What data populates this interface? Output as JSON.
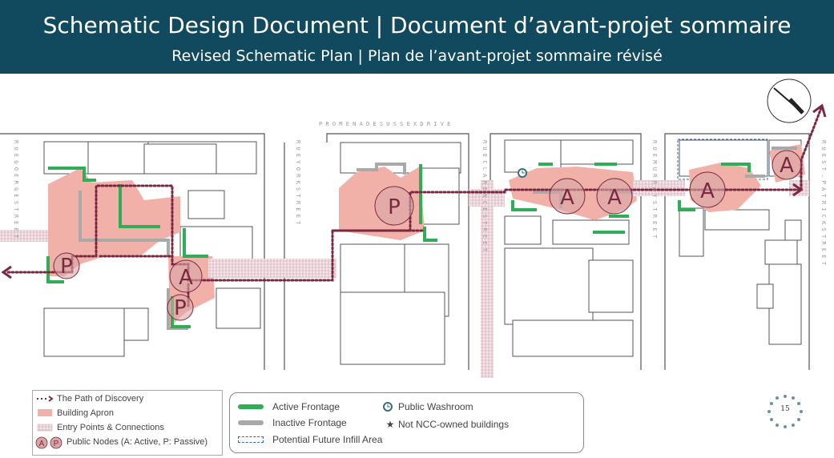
{
  "header": {
    "title": "Schematic Design Document | Document d’avant-projet sommaire",
    "subtitle": "Revised Schematic Plan | Plan de l’avant-projet sommaire révisé"
  },
  "streets": {
    "promenade": "P R O M E N A D E   S U S S E X   D R I V E",
    "george": "R U E   G O E R G E   S T R E E T",
    "york": "R U E   Y O R K   S T R E E T",
    "clarence": "R U E   C L A R E N C E   S T R E E T",
    "murray": "R U E   M U R R A Y   S T R E E T",
    "st_patrick": "R U E   S T .   P A T R I C K   S T R E E T"
  },
  "nodes": {
    "active": "A",
    "passive": "P"
  },
  "legend_left": {
    "path": "The Path of Discovery",
    "apron": "Building Apron",
    "entry": "Entry Points & Connections",
    "nodes": "Public Nodes (A: Active, P: Passive)",
    "node_a": "A",
    "node_p": "P"
  },
  "legend_mid": {
    "active": "Active Frontage",
    "inactive": "Inactive Frontage",
    "infill": "Potential Future Infill Area",
    "washroom": "Public Washroom",
    "ncc": "Not NCC-owned buildings",
    "ncc_symbol": "★"
  },
  "page_number": "15",
  "colors": {
    "header_bg": "#114a5e",
    "apron": "#f1b1a8",
    "active_frontage": "#2fae57",
    "inactive_frontage": "#a9a9a9",
    "path": "#7a2a40",
    "infill": "#2b6cb0"
  }
}
